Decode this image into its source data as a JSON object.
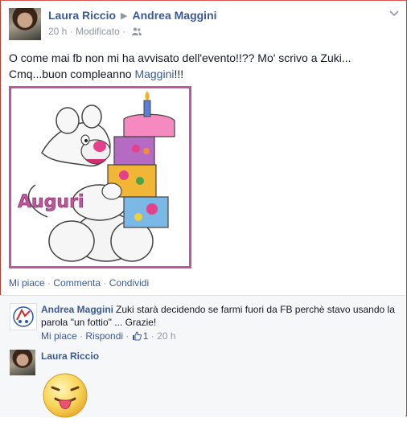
{
  "post": {
    "author": "Laura Riccio",
    "target": "Andrea Maggini",
    "time": "20 h",
    "edited": "Modificato",
    "text_line1": "O come mai fb non mi ha avvisato dell'evento!!?? Mo' scrivo a Zuki...",
    "text_line2_prefix": "Cmq...buon compleanno ",
    "text_line2_mention": "Maggini",
    "text_line2_suffix": "!!!",
    "image_caption": "Auguri"
  },
  "actions": {
    "like": "Mi piace",
    "comment": "Commenta",
    "share": "Condividi",
    "sep": "·"
  },
  "comments": [
    {
      "author": "Andrea Maggini",
      "text": "Zuki starà decidendo se farmi fuori da FB perchè stavo usando la parola \"un fottio\" ... Grazie!",
      "like": "Mi piace",
      "reply": "Rispondi",
      "likes": "1",
      "time": "20 h"
    },
    {
      "author": "Laura Riccio"
    }
  ],
  "colors": {
    "link": "#3b5998",
    "meta": "#9197a3",
    "photo_border": "#c2569b"
  },
  "icons": {
    "audience": "friends-icon",
    "chevron": "chevron-down-icon",
    "thumb": "thumbs-up-icon",
    "emoji": "tongue-out-emoji-icon"
  }
}
